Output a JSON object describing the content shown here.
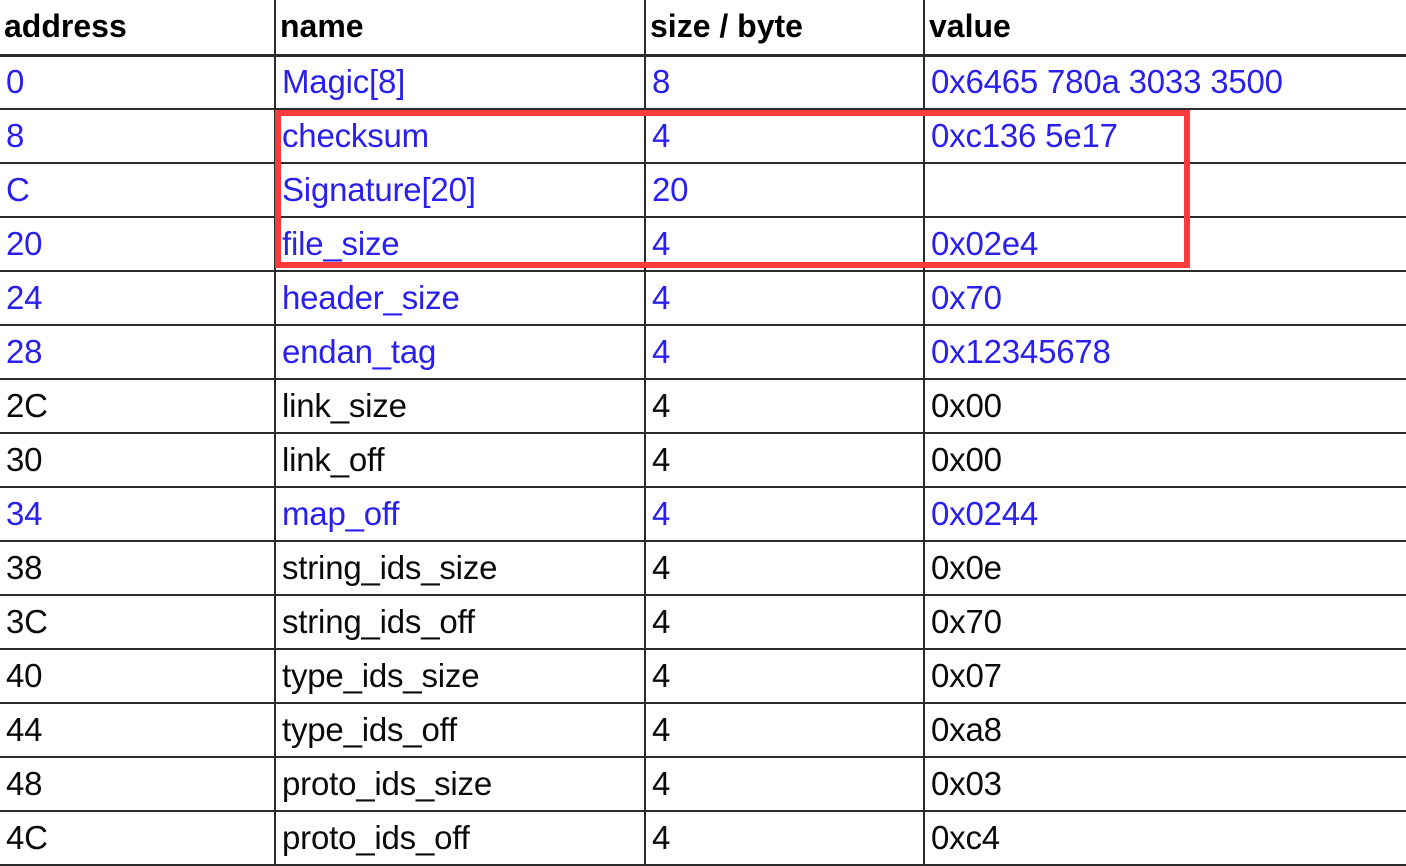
{
  "table": {
    "columns": [
      {
        "key": "address",
        "label": "address"
      },
      {
        "key": "name",
        "label": "name"
      },
      {
        "key": "size",
        "label": "size / byte"
      },
      {
        "key": "value",
        "label": "value"
      }
    ],
    "rows": [
      {
        "address": "0",
        "name": "Magic[8]",
        "size": "8",
        "value": "0x6465 780a 3033 3500",
        "tone": "blue"
      },
      {
        "address": "8",
        "name": "checksum",
        "size": "4",
        "value": "0xc136 5e17",
        "tone": "blue"
      },
      {
        "address": "C",
        "name": "Signature[20]",
        "size": "20",
        "value": "",
        "tone": "blue"
      },
      {
        "address": "20",
        "name": "file_size",
        "size": "4",
        "value": "0x02e4",
        "tone": "blue"
      },
      {
        "address": "24",
        "name": "header_size",
        "size": "4",
        "value": "0x70",
        "tone": "blue"
      },
      {
        "address": "28",
        "name": "endan_tag",
        "size": "4",
        "value": "0x12345678",
        "tone": "blue"
      },
      {
        "address": "2C",
        "name": "link_size",
        "size": "4",
        "value": "0x00",
        "tone": "black"
      },
      {
        "address": "30",
        "name": "link_off",
        "size": "4",
        "value": "0x00",
        "tone": "black"
      },
      {
        "address": "34",
        "name": "map_off",
        "size": "4",
        "value": "0x0244",
        "tone": "blue"
      },
      {
        "address": "38",
        "name": "string_ids_size",
        "size": "4",
        "value": "0x0e",
        "tone": "black"
      },
      {
        "address": "3C",
        "name": "string_ids_off",
        "size": "4",
        "value": "0x70",
        "tone": "black"
      },
      {
        "address": "40",
        "name": "type_ids_size",
        "size": "4",
        "value": "0x07",
        "tone": "black"
      },
      {
        "address": "44",
        "name": "type_ids_off",
        "size": "4",
        "value": "0xa8",
        "tone": "black"
      },
      {
        "address": "48",
        "name": "proto_ids_size",
        "size": "4",
        "value": "0x03",
        "tone": "black"
      },
      {
        "address": "4C",
        "name": "proto_ids_off",
        "size": "4",
        "value": "0xc4",
        "tone": "black"
      }
    ]
  },
  "annotation": {
    "highlight_color": "#fb3b3b",
    "highlight_rows": [
      "checksum",
      "Signature[20]",
      "file_size"
    ]
  },
  "colors": {
    "blue_text": "#2a20ee",
    "black_text": "#0a0a0a",
    "grid_line": "#2b2b2b",
    "background": "#ffffff"
  }
}
